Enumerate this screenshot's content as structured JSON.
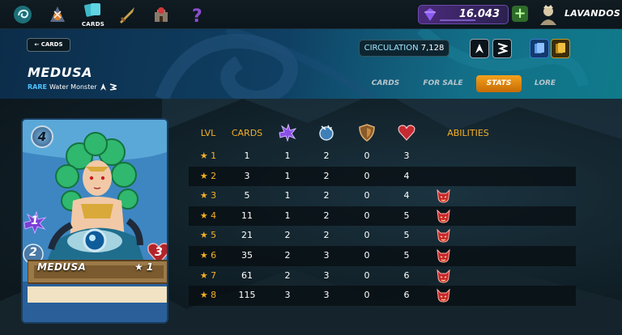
{
  "topbar": {
    "nav": [
      {
        "name": "splinterlands-logo-icon"
      },
      {
        "name": "battle-icon"
      },
      {
        "name": "cards-icon",
        "label": "CARDS"
      },
      {
        "name": "sword-icon"
      },
      {
        "name": "castle-icon"
      },
      {
        "name": "question-icon"
      }
    ],
    "dec_balance": "16.043",
    "plus_label": "+",
    "username": "LAVANDOS"
  },
  "header": {
    "back_label": "← CARDS",
    "card_name": "MEDUSA",
    "rarity": "RARE",
    "type": "Water Monster",
    "circulation_label": "CIRCULATION",
    "circulation_value": "7,128",
    "tabs": [
      "CARDS",
      "FOR SALE",
      "STATS",
      "LORE"
    ],
    "active_tab": "STATS"
  },
  "card": {
    "mana": "4",
    "melee": "1",
    "speed": "2",
    "health": "3",
    "name": "MEDUSA",
    "level": "★ 1",
    "colors": {
      "water": "#2d6fb0",
      "banner": "#8a6a3a"
    }
  },
  "table": {
    "headers": {
      "lvl": "LVL",
      "cards": "CARDS",
      "abilities": "ABILITIES"
    },
    "header_icons": [
      "melee-icon",
      "speed-icon",
      "armor-icon",
      "health-icon"
    ],
    "rows": [
      {
        "lvl": "★ 1",
        "cards": "1",
        "melee": "1",
        "speed": "2",
        "armor": "0",
        "health": "3",
        "ability": false
      },
      {
        "lvl": "★ 2",
        "cards": "3",
        "melee": "1",
        "speed": "2",
        "armor": "0",
        "health": "4",
        "ability": false
      },
      {
        "lvl": "★ 3",
        "cards": "5",
        "melee": "1",
        "speed": "2",
        "armor": "0",
        "health": "4",
        "ability": true
      },
      {
        "lvl": "★ 4",
        "cards": "11",
        "melee": "1",
        "speed": "2",
        "armor": "0",
        "health": "5",
        "ability": true
      },
      {
        "lvl": "★ 5",
        "cards": "21",
        "melee": "2",
        "speed": "2",
        "armor": "0",
        "health": "5",
        "ability": true
      },
      {
        "lvl": "★ 6",
        "cards": "35",
        "melee": "2",
        "speed": "3",
        "armor": "0",
        "health": "5",
        "ability": true
      },
      {
        "lvl": "★ 7",
        "cards": "61",
        "melee": "2",
        "speed": "3",
        "armor": "0",
        "health": "6",
        "ability": true
      },
      {
        "lvl": "★ 8",
        "cards": "115",
        "melee": "3",
        "speed": "3",
        "armor": "0",
        "health": "6",
        "ability": true
      }
    ],
    "ability_icon": "demon-ability-icon"
  }
}
